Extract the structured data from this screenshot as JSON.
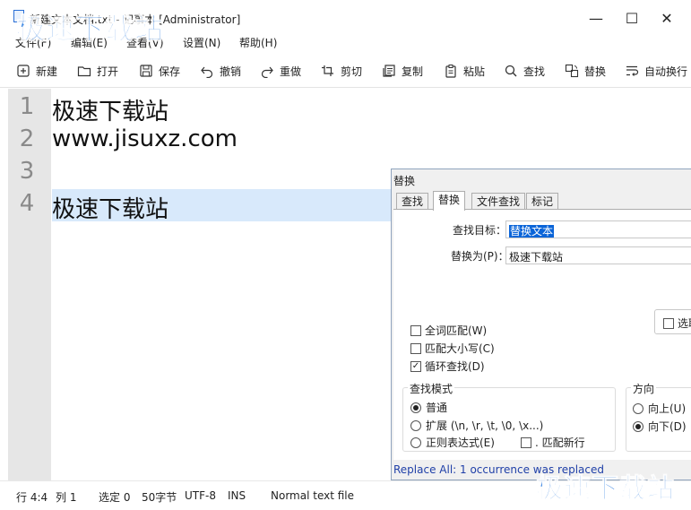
{
  "window": {
    "title": "新建文本文档.txt - 记事本 [Administrator]",
    "controls": {
      "minimize": "—",
      "maximize": "☐",
      "close": "✕"
    }
  },
  "watermark": {
    "top": "极速下载站",
    "bottom": "极速下载站"
  },
  "menu": [
    "文件(F)",
    "编辑(E)",
    "查看(V)",
    "设置(N)",
    "帮助(H)"
  ],
  "toolbar": [
    {
      "label": "新建",
      "icon": "new-file-icon"
    },
    {
      "label": "打开",
      "icon": "open-folder-icon"
    },
    {
      "label": "保存",
      "icon": "save-icon"
    },
    {
      "label": "撤销",
      "icon": "undo-icon"
    },
    {
      "label": "重做",
      "icon": "redo-icon"
    },
    {
      "label": "剪切",
      "icon": "cut-icon"
    },
    {
      "label": "复制",
      "icon": "copy-icon"
    },
    {
      "label": "粘贴",
      "icon": "paste-icon"
    },
    {
      "label": "查找",
      "icon": "search-icon"
    },
    {
      "label": "替换",
      "icon": "replace-icon"
    },
    {
      "label": "自动换行",
      "icon": "wrap-icon"
    }
  ],
  "editor": {
    "line_numbers": [
      "1",
      "2",
      "3",
      "4"
    ],
    "lines": [
      "极速下载站",
      "www.jisuxz.com",
      "",
      "极速下载站"
    ]
  },
  "status": {
    "position": "行 4:4",
    "column": "列 1",
    "selection": "选定 0",
    "bytes": "50字节",
    "encoding": "UTF-8",
    "mode": "INS",
    "file_type": "Normal text file"
  },
  "dialog": {
    "title": "替换",
    "tabs": [
      "查找",
      "替换",
      "文件查找",
      "标记"
    ],
    "active_tab": "替换",
    "find_label": "查找目标：",
    "find_value": "替换文本",
    "replace_label": "替换为(P)：",
    "replace_value": "极速下载站",
    "selection_only": "选取",
    "options": [
      {
        "label": "全词匹配(W)",
        "checked": false
      },
      {
        "label": "匹配大小写(C)",
        "checked": false
      },
      {
        "label": "循环查找(D)",
        "checked": true
      }
    ],
    "search_mode": {
      "title": "查找模式",
      "items": [
        {
          "label": "普通",
          "selected": true
        },
        {
          "label": "扩展 (\\n, \\r, \\t, \\0, \\x...)",
          "selected": false
        },
        {
          "label": "正则表达式(E)",
          "selected": false
        }
      ],
      "match_newline": ". 匹配新行"
    },
    "direction": {
      "title": "方向",
      "items": [
        {
          "label": "向上(U)",
          "selected": false
        },
        {
          "label": "向下(D)",
          "selected": true
        }
      ]
    },
    "result": "Replace All: 1 occurrence was replaced"
  }
}
